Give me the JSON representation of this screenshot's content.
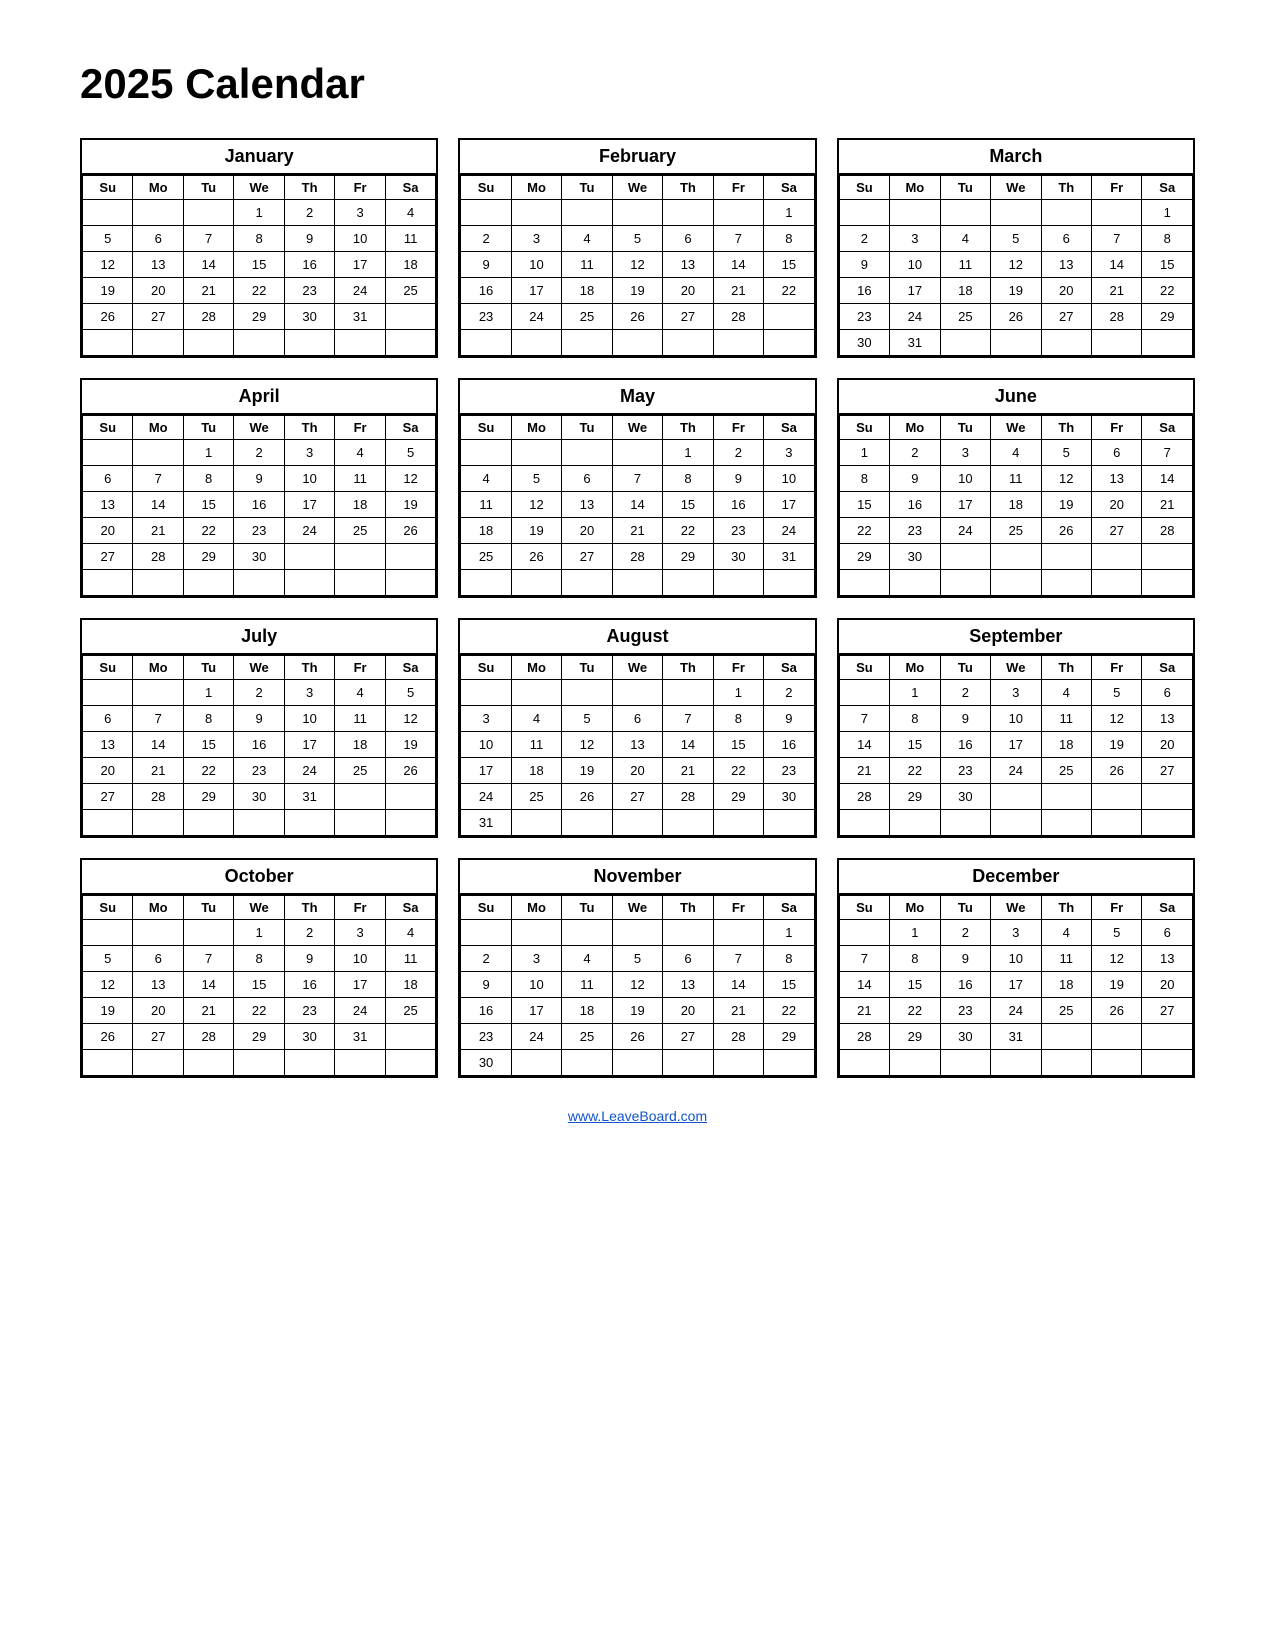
{
  "title": "2025 Calendar",
  "footer_link": "www.LeaveBoard.com",
  "months": [
    {
      "name": "January",
      "days": [
        "Su",
        "Mo",
        "Tu",
        "We",
        "Th",
        "Fr",
        "Sa"
      ],
      "weeks": [
        [
          "",
          "",
          "",
          "1",
          "2",
          "3",
          "4"
        ],
        [
          "5",
          "6",
          "7",
          "8",
          "9",
          "10",
          "11"
        ],
        [
          "12",
          "13",
          "14",
          "15",
          "16",
          "17",
          "18"
        ],
        [
          "19",
          "20",
          "21",
          "22",
          "23",
          "24",
          "25"
        ],
        [
          "26",
          "27",
          "28",
          "29",
          "30",
          "31",
          ""
        ],
        [
          "",
          "",
          "",
          "",
          "",
          "",
          ""
        ]
      ]
    },
    {
      "name": "February",
      "days": [
        "Su",
        "Mo",
        "Tu",
        "We",
        "Th",
        "Fr",
        "Sa"
      ],
      "weeks": [
        [
          "",
          "",
          "",
          "",
          "",
          "",
          "1"
        ],
        [
          "2",
          "3",
          "4",
          "5",
          "6",
          "7",
          "8"
        ],
        [
          "9",
          "10",
          "11",
          "12",
          "13",
          "14",
          "15"
        ],
        [
          "16",
          "17",
          "18",
          "19",
          "20",
          "21",
          "22"
        ],
        [
          "23",
          "24",
          "25",
          "26",
          "27",
          "28",
          ""
        ],
        [
          "",
          "",
          "",
          "",
          "",
          "",
          ""
        ]
      ]
    },
    {
      "name": "March",
      "days": [
        "Su",
        "Mo",
        "Tu",
        "We",
        "Th",
        "Fr",
        "Sa"
      ],
      "weeks": [
        [
          "",
          "",
          "",
          "",
          "",
          "",
          "1"
        ],
        [
          "2",
          "3",
          "4",
          "5",
          "6",
          "7",
          "8"
        ],
        [
          "9",
          "10",
          "11",
          "12",
          "13",
          "14",
          "15"
        ],
        [
          "16",
          "17",
          "18",
          "19",
          "20",
          "21",
          "22"
        ],
        [
          "23",
          "24",
          "25",
          "26",
          "27",
          "28",
          "29"
        ],
        [
          "30",
          "31",
          "",
          "",
          "",
          "",
          ""
        ]
      ]
    },
    {
      "name": "April",
      "days": [
        "Su",
        "Mo",
        "Tu",
        "We",
        "Th",
        "Fr",
        "Sa"
      ],
      "weeks": [
        [
          "",
          "",
          "1",
          "2",
          "3",
          "4",
          "5"
        ],
        [
          "6",
          "7",
          "8",
          "9",
          "10",
          "11",
          "12"
        ],
        [
          "13",
          "14",
          "15",
          "16",
          "17",
          "18",
          "19"
        ],
        [
          "20",
          "21",
          "22",
          "23",
          "24",
          "25",
          "26"
        ],
        [
          "27",
          "28",
          "29",
          "30",
          "",
          "",
          ""
        ],
        [
          "",
          "",
          "",
          "",
          "",
          "",
          ""
        ]
      ]
    },
    {
      "name": "May",
      "days": [
        "Su",
        "Mo",
        "Tu",
        "We",
        "Th",
        "Fr",
        "Sa"
      ],
      "weeks": [
        [
          "",
          "",
          "",
          "",
          "1",
          "2",
          "3"
        ],
        [
          "4",
          "5",
          "6",
          "7",
          "8",
          "9",
          "10"
        ],
        [
          "11",
          "12",
          "13",
          "14",
          "15",
          "16",
          "17"
        ],
        [
          "18",
          "19",
          "20",
          "21",
          "22",
          "23",
          "24"
        ],
        [
          "25",
          "26",
          "27",
          "28",
          "29",
          "30",
          "31"
        ],
        [
          "",
          "",
          "",
          "",
          "",
          "",
          ""
        ]
      ]
    },
    {
      "name": "June",
      "days": [
        "Su",
        "Mo",
        "Tu",
        "We",
        "Th",
        "Fr",
        "Sa"
      ],
      "weeks": [
        [
          "1",
          "2",
          "3",
          "4",
          "5",
          "6",
          "7"
        ],
        [
          "8",
          "9",
          "10",
          "11",
          "12",
          "13",
          "14"
        ],
        [
          "15",
          "16",
          "17",
          "18",
          "19",
          "20",
          "21"
        ],
        [
          "22",
          "23",
          "24",
          "25",
          "26",
          "27",
          "28"
        ],
        [
          "29",
          "30",
          "",
          "",
          "",
          "",
          ""
        ],
        [
          "",
          "",
          "",
          "",
          "",
          "",
          ""
        ]
      ]
    },
    {
      "name": "July",
      "days": [
        "Su",
        "Mo",
        "Tu",
        "We",
        "Th",
        "Fr",
        "Sa"
      ],
      "weeks": [
        [
          "",
          "",
          "1",
          "2",
          "3",
          "4",
          "5"
        ],
        [
          "6",
          "7",
          "8",
          "9",
          "10",
          "11",
          "12"
        ],
        [
          "13",
          "14",
          "15",
          "16",
          "17",
          "18",
          "19"
        ],
        [
          "20",
          "21",
          "22",
          "23",
          "24",
          "25",
          "26"
        ],
        [
          "27",
          "28",
          "29",
          "30",
          "31",
          "",
          ""
        ],
        [
          "",
          "",
          "",
          "",
          "",
          "",
          ""
        ]
      ]
    },
    {
      "name": "August",
      "days": [
        "Su",
        "Mo",
        "Tu",
        "We",
        "Th",
        "Fr",
        "Sa"
      ],
      "weeks": [
        [
          "",
          "",
          "",
          "",
          "",
          "1",
          "2"
        ],
        [
          "3",
          "4",
          "5",
          "6",
          "7",
          "8",
          "9"
        ],
        [
          "10",
          "11",
          "12",
          "13",
          "14",
          "15",
          "16"
        ],
        [
          "17",
          "18",
          "19",
          "20",
          "21",
          "22",
          "23"
        ],
        [
          "24",
          "25",
          "26",
          "27",
          "28",
          "29",
          "30"
        ],
        [
          "31",
          "",
          "",
          "",
          "",
          "",
          ""
        ]
      ]
    },
    {
      "name": "September",
      "days": [
        "Su",
        "Mo",
        "Tu",
        "We",
        "Th",
        "Fr",
        "Sa"
      ],
      "weeks": [
        [
          "",
          "1",
          "2",
          "3",
          "4",
          "5",
          "6"
        ],
        [
          "7",
          "8",
          "9",
          "10",
          "11",
          "12",
          "13"
        ],
        [
          "14",
          "15",
          "16",
          "17",
          "18",
          "19",
          "20"
        ],
        [
          "21",
          "22",
          "23",
          "24",
          "25",
          "26",
          "27"
        ],
        [
          "28",
          "29",
          "30",
          "",
          "",
          "",
          ""
        ],
        [
          "",
          "",
          "",
          "",
          "",
          "",
          ""
        ]
      ]
    },
    {
      "name": "October",
      "days": [
        "Su",
        "Mo",
        "Tu",
        "We",
        "Th",
        "Fr",
        "Sa"
      ],
      "weeks": [
        [
          "",
          "",
          "",
          "1",
          "2",
          "3",
          "4"
        ],
        [
          "5",
          "6",
          "7",
          "8",
          "9",
          "10",
          "11"
        ],
        [
          "12",
          "13",
          "14",
          "15",
          "16",
          "17",
          "18"
        ],
        [
          "19",
          "20",
          "21",
          "22",
          "23",
          "24",
          "25"
        ],
        [
          "26",
          "27",
          "28",
          "29",
          "30",
          "31",
          ""
        ],
        [
          "",
          "",
          "",
          "",
          "",
          "",
          ""
        ]
      ]
    },
    {
      "name": "November",
      "days": [
        "Su",
        "Mo",
        "Tu",
        "We",
        "Th",
        "Fr",
        "Sa"
      ],
      "weeks": [
        [
          "",
          "",
          "",
          "",
          "",
          "",
          "1"
        ],
        [
          "2",
          "3",
          "4",
          "5",
          "6",
          "7",
          "8"
        ],
        [
          "9",
          "10",
          "11",
          "12",
          "13",
          "14",
          "15"
        ],
        [
          "16",
          "17",
          "18",
          "19",
          "20",
          "21",
          "22"
        ],
        [
          "23",
          "24",
          "25",
          "26",
          "27",
          "28",
          "29"
        ],
        [
          "30",
          "",
          "",
          "",
          "",
          "",
          ""
        ]
      ]
    },
    {
      "name": "December",
      "days": [
        "Su",
        "Mo",
        "Tu",
        "We",
        "Th",
        "Fr",
        "Sa"
      ],
      "weeks": [
        [
          "",
          "1",
          "2",
          "3",
          "4",
          "5",
          "6"
        ],
        [
          "7",
          "8",
          "9",
          "10",
          "11",
          "12",
          "13"
        ],
        [
          "14",
          "15",
          "16",
          "17",
          "18",
          "19",
          "20"
        ],
        [
          "21",
          "22",
          "23",
          "24",
          "25",
          "26",
          "27"
        ],
        [
          "28",
          "29",
          "30",
          "31",
          "",
          "",
          ""
        ],
        [
          "",
          "",
          "",
          "",
          "",
          "",
          ""
        ]
      ]
    }
  ]
}
